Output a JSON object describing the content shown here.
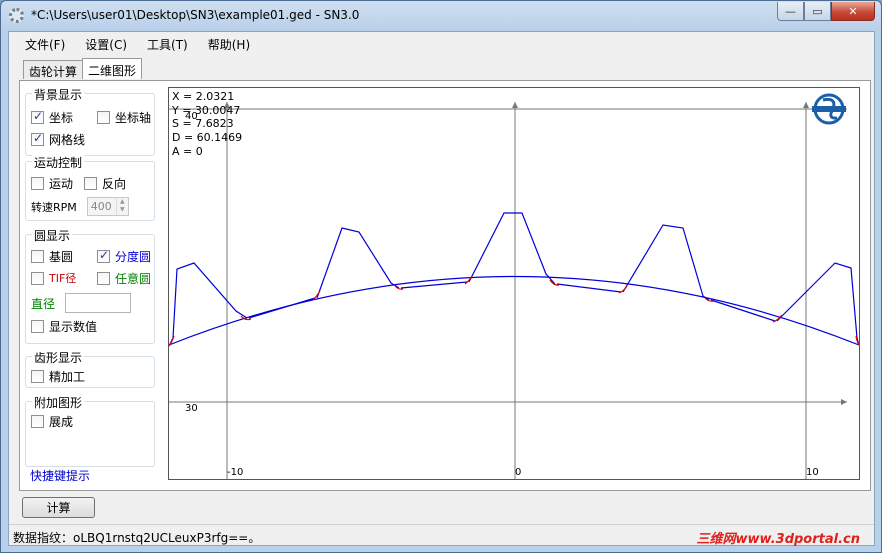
{
  "window": {
    "title": "*C:\\Users\\user01\\Desktop\\SN3\\example01.ged - SN3.0",
    "minimize_glyph": "—",
    "maximize_glyph": "▭",
    "close_glyph": "✕"
  },
  "menu": [
    "文件(F)",
    "设置(C)",
    "工具(T)",
    "帮助(H)"
  ],
  "tabs": [
    "齿轮计算",
    "二维图形"
  ],
  "panel": {
    "background": {
      "title": "背景显示",
      "coords": {
        "label": "坐标",
        "checked": true
      },
      "axes": {
        "label": "坐标轴",
        "checked": false
      },
      "grid": {
        "label": "网格线",
        "checked": true
      }
    },
    "motion": {
      "title": "运动控制",
      "move": {
        "label": "运动",
        "checked": false
      },
      "reverse": {
        "label": "反向",
        "checked": false
      },
      "speed_label": "转速RPM",
      "speed_value": "400"
    },
    "circles": {
      "title": "圆显示",
      "base": {
        "label": "基圆",
        "checked": false
      },
      "pitch": {
        "label": "分度圆",
        "checked": true
      },
      "tip": {
        "label": "TIF径",
        "checked": false
      },
      "any": {
        "label": "任意圆",
        "checked": false
      },
      "diameter_label": "直径",
      "diameter_value": "",
      "show_values": {
        "label": "显示数值",
        "checked": false
      }
    },
    "tooth": {
      "title": "齿形显示",
      "finish": {
        "label": "精加工",
        "checked": false
      }
    },
    "extra": {
      "title": "附加图形",
      "generate": {
        "label": "展成",
        "checked": false
      }
    },
    "shortcut_link": "快捷键提示"
  },
  "canvas": {
    "readout": [
      "X = 2.0321",
      "Y = 30.0047",
      "S = 7.6823",
      "D = 60.1469",
      "A = 0"
    ],
    "y_ticks": [
      "40",
      "30"
    ],
    "x_ticks": [
      "-10",
      "0",
      "10"
    ],
    "colors": {
      "profile": "#0000dd",
      "fillet": "#dd0000",
      "axis": "#777777"
    }
  },
  "calc_button": "计算",
  "status": {
    "fingerprint": "数据指纹：oLBQ1rnstq2UCLeuxP3rfg==。",
    "watermark": "三维网www.3dportal.cn"
  }
}
